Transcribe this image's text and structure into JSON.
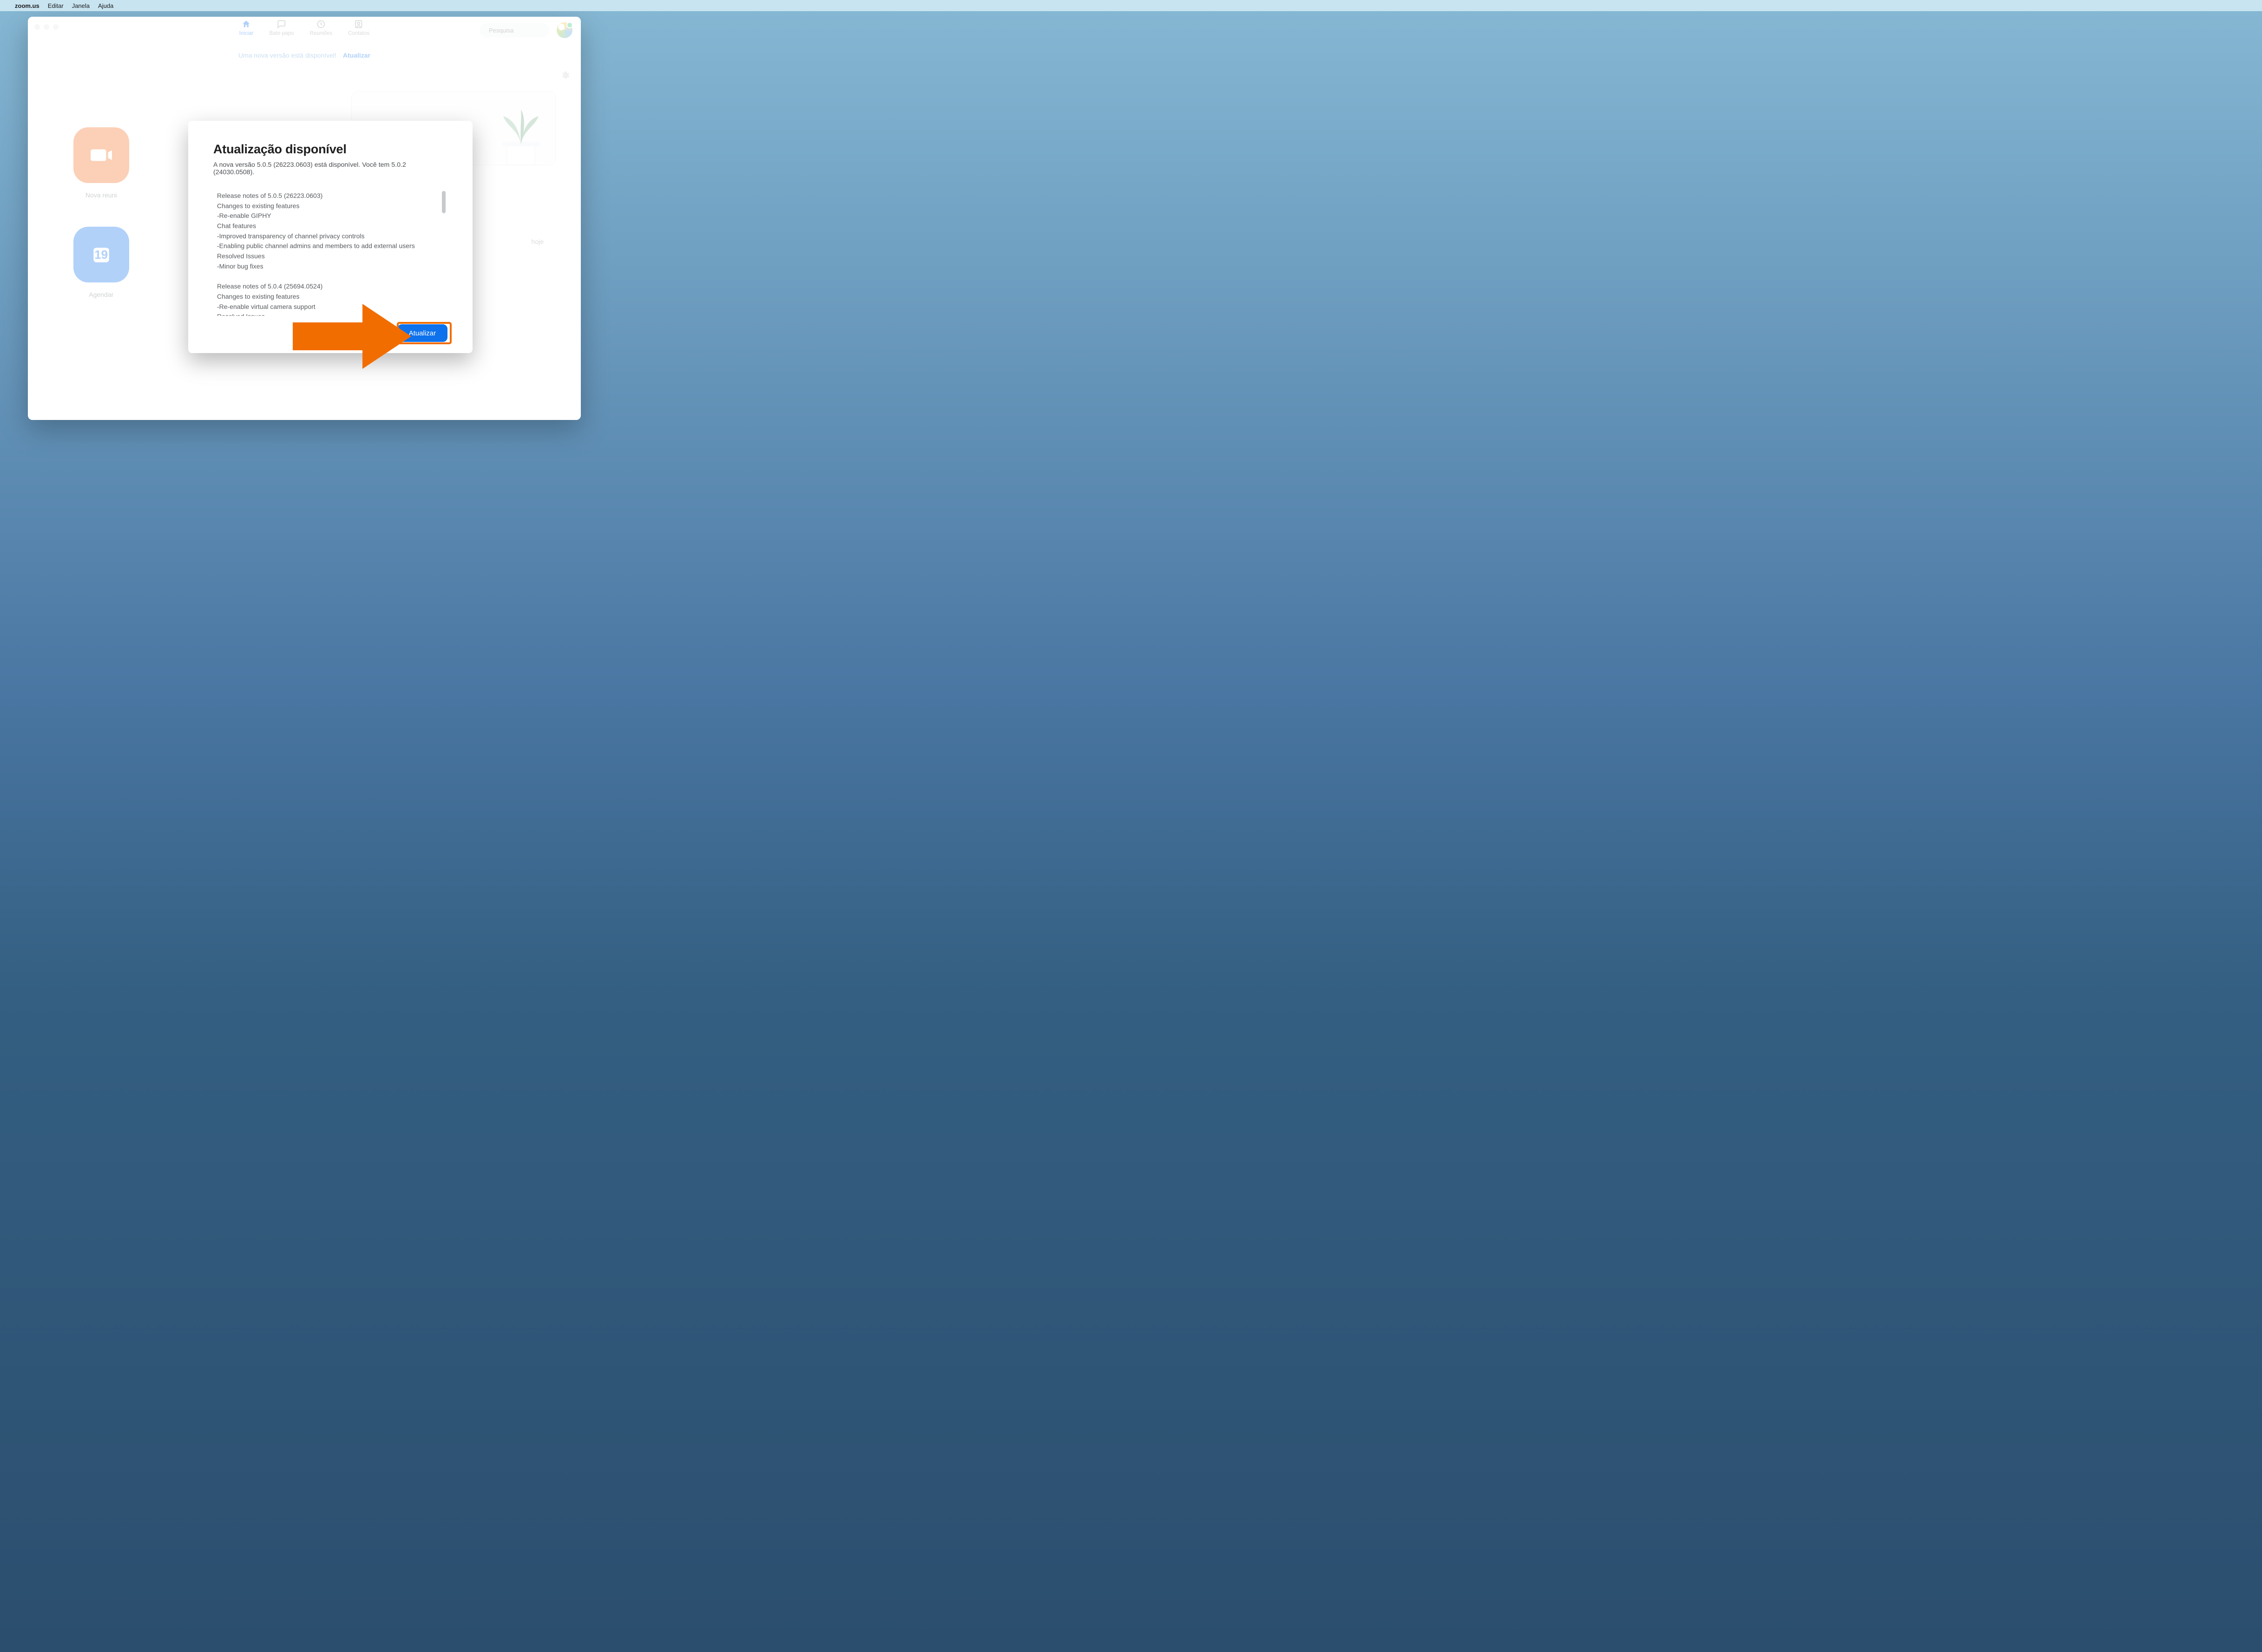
{
  "menubar": {
    "app": "zoom.us",
    "items": [
      "Editar",
      "Janela",
      "Ajuda"
    ]
  },
  "header": {
    "tabs": [
      {
        "id": "home",
        "label": "Iniciar",
        "active": true
      },
      {
        "id": "chat",
        "label": "Bate-papo",
        "active": false
      },
      {
        "id": "meetings",
        "label": "Reuniões",
        "active": false
      },
      {
        "id": "contacts",
        "label": "Contatos",
        "active": false
      }
    ],
    "search_placeholder": "Pesquisa"
  },
  "banner": {
    "text": "Uma nova versão está disponível!",
    "action": "Atualizar"
  },
  "tiles": {
    "new_meeting": "Nova reuni",
    "schedule": "Agendar",
    "calendar_day": "19"
  },
  "right": {
    "today_label": "hoje"
  },
  "modal": {
    "title": "Atualização disponível",
    "subtitle": "A nova versão 5.0.5 (26223.0603) está disponível. Você tem 5.0.2 (24030.0508).",
    "notes": "Release notes of 5.0.5 (26223.0603)\nChanges to existing features\n-Re-enable GIPHY\nChat features\n-Improved transparency of channel privacy controls\n-Enabling public channel admins and members to add external users\nResolved Issues\n-Minor bug fixes\n\nRelease notes of 5.0.4 (25694.0524)\nChanges to existing features\n-Re-enable virtual camera support\nResolved Issues\n-Minor Bug Fixes",
    "update_btn": "Atualizar"
  },
  "colors": {
    "accent": "#0e72ed",
    "highlight": "#f26d00"
  }
}
